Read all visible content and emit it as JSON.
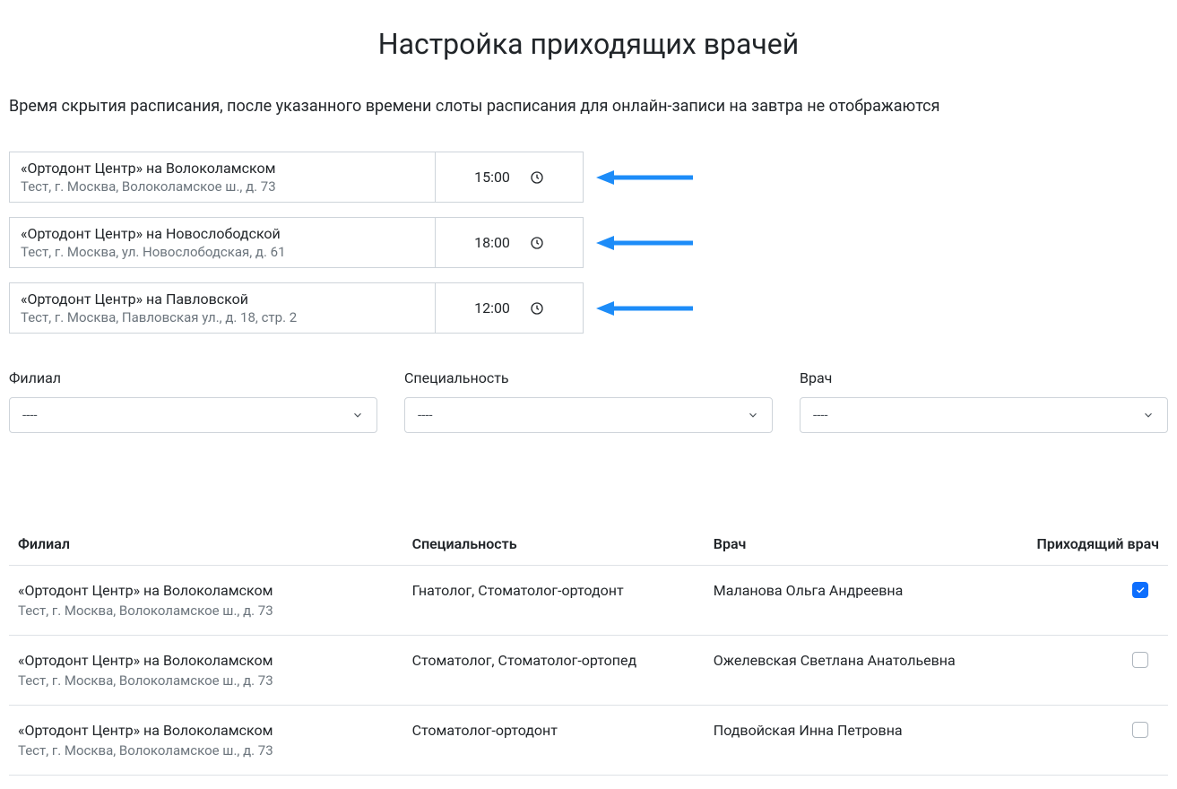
{
  "title": "Настройка приходящих врачей",
  "description": "Время скрытия расписания, после указанного времени слоты расписания для онлайн-записи на завтра не отображаются",
  "branches": [
    {
      "name": "«Ортодонт Центр» на Волоколамском",
      "address": "Тест, г. Москва, Волоколамское ш., д. 73",
      "time": "15:00"
    },
    {
      "name": "«Ортодонт Центр» на Новослободской",
      "address": "Тест, г. Москва, ул. Новослободская, д. 61",
      "time": "18:00"
    },
    {
      "name": "«Ортодонт Центр» на Павловской",
      "address": "Тест, г. Москва, Павловская ул., д. 18, стр. 2",
      "time": "12:00"
    }
  ],
  "filters": {
    "branch": {
      "label": "Филиал",
      "value": "----"
    },
    "specialty": {
      "label": "Специальность",
      "value": "----"
    },
    "doctor": {
      "label": "Врач",
      "value": "----"
    }
  },
  "table": {
    "headers": {
      "branch": "Филиал",
      "specialty": "Специальность",
      "doctor": "Врач",
      "visiting": "Приходящий врач"
    },
    "rows": [
      {
        "branch_name": "«Ортодонт Центр» на Волоколамском",
        "branch_address": "Тест, г. Москва, Волоколамское ш., д. 73",
        "specialty": "Гнатолог, Стоматолог-ортодонт",
        "doctor": "Маланова Ольга Андреевна",
        "visiting": true
      },
      {
        "branch_name": "«Ортодонт Центр» на Волоколамском",
        "branch_address": "Тест, г. Москва, Волоколамское ш., д. 73",
        "specialty": "Стоматолог, Стоматолог-ортопед",
        "doctor": "Ожелевская Светлана Анатольевна",
        "visiting": false
      },
      {
        "branch_name": "«Ортодонт Центр» на Волоколамском",
        "branch_address": "Тест, г. Москва, Волоколамское ш., д. 73",
        "specialty": "Стоматолог-ортодонт",
        "doctor": "Подвойская Инна Петровна",
        "visiting": false
      }
    ]
  },
  "colors": {
    "arrow": "#1d8cf8",
    "primary": "#0d6efd"
  }
}
